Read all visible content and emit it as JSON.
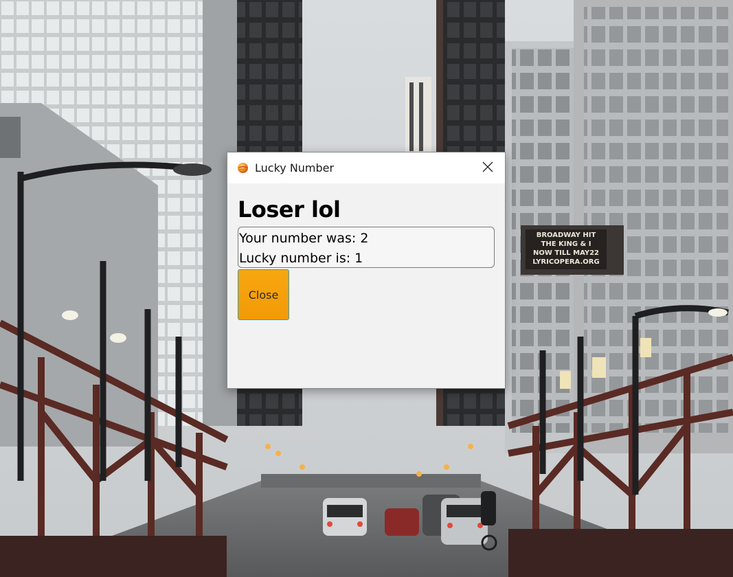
{
  "window": {
    "title": "Lucky Number",
    "app_icon": "orange-ball-icon",
    "close_icon": "close-icon"
  },
  "content": {
    "heading": "Loser lol",
    "result_lines": [
      "Your number was: 2",
      "Lucky number is: 1"
    ],
    "close_button_label": "Close"
  },
  "background": {
    "billboard_lines": [
      "BROADWAY HIT",
      "THE KING & I",
      "NOW TILL MAY22",
      "LYRICOPERA.ORG"
    ]
  },
  "colors": {
    "button_fill": "#f29a07",
    "button_border": "#2aa1c7",
    "dialog_bg": "#f2f2f2",
    "titlebar_bg": "#ffffff"
  }
}
